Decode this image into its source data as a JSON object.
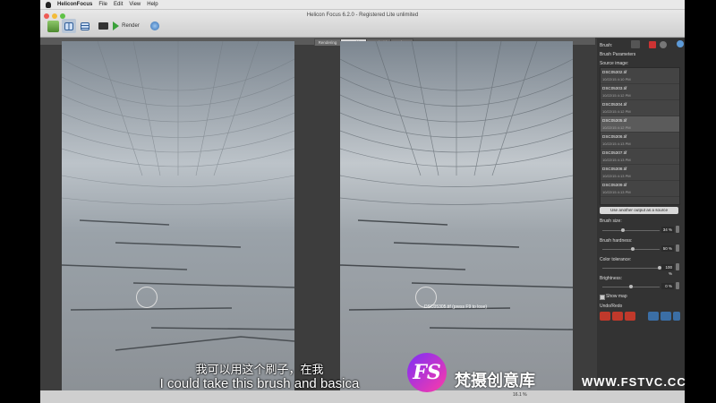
{
  "menubar": {
    "app": "HeliconFocus",
    "items": [
      "File",
      "Edit",
      "View",
      "Help"
    ]
  },
  "window": {
    "title": "Helicon Focus 6.2.0 - Registered Lite unlimited"
  },
  "toolbar": {
    "render_label": "Render"
  },
  "tabs": [
    "Rendering",
    "Retouching",
    "Text/Grid",
    "Colors"
  ],
  "panel": {
    "brush_label": "Brush:",
    "brush_params": "Brush Parameters",
    "source_image_label": "Source image:",
    "sources": [
      {
        "name": "DSC05302.tif",
        "date": "10/22/15 4:10 PM"
      },
      {
        "name": "DSC05303.tif",
        "date": "10/22/15 4:12 PM"
      },
      {
        "name": "DSC05304.tif",
        "date": "10/22/15 4:12 PM"
      },
      {
        "name": "DSC05305.tif",
        "date": "10/22/15 4:12 PM"
      },
      {
        "name": "DSC05306.tif",
        "date": "10/22/15 4:13 PM"
      },
      {
        "name": "DSC05307.tif",
        "date": "10/22/15 4:13 PM"
      },
      {
        "name": "DSC05308.tif",
        "date": "10/22/15 4:13 PM"
      },
      {
        "name": "DSC05309.tif",
        "date": "10/22/15 4:13 PM"
      }
    ],
    "use_output_btn": "Use another output as a source",
    "brush_size_label": "Brush size:",
    "brush_size_value": "34 %",
    "brush_hardness_label": "Brush hardness:",
    "brush_hardness_value": "50 %",
    "color_tolerance_label": "Color tolerance:",
    "color_tolerance_value": "100 %",
    "brightness_label": "Brightness:",
    "brightness_value": "0 %",
    "show_map_label": "Show map",
    "undo_redo_label": "Undo/Redo"
  },
  "tooltip": "DSC05305.tif (press F9 to lose)",
  "subtitles": {
    "cn": "我可以用这个刷子，在我",
    "en": "I could take this brush and basica"
  },
  "watermark": {
    "logo": "FS",
    "cn": "梵摄创意库",
    "url": "WWW.FSTVC.CC"
  },
  "status": {
    "zoom": "16.1 %"
  },
  "colors": {
    "panel": "#333333",
    "workspace": "#3d3d3d"
  }
}
